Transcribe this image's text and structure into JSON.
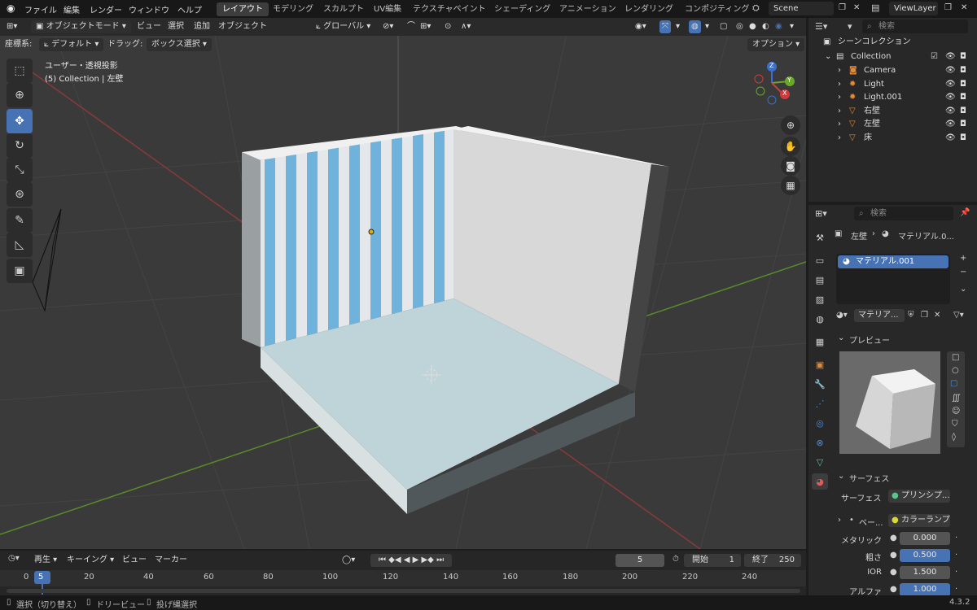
{
  "top_menu": {
    "items": [
      "ファイル",
      "編集",
      "レンダー",
      "ウィンドウ",
      "ヘルプ"
    ]
  },
  "workspace_tabs": [
    "レイアウト",
    "モデリング",
    "スカルプト",
    "UV編集",
    "テクスチャペイント",
    "シェーディング",
    "アニメーション",
    "レンダリング",
    "コンポジティング"
  ],
  "scene": {
    "name": "Scene",
    "view_layer": "ViewLayer"
  },
  "viewport": {
    "mode": "オブジェクトモード",
    "menus": [
      "ビュー",
      "選択",
      "追加",
      "オブジェクト"
    ],
    "transform_orientation": "グローバル",
    "coord_label": "座標系:",
    "coord_value": "デフォルト",
    "drag_label": "ドラッグ:",
    "drag_value": "ボックス選択",
    "options": "オプション",
    "overlay_title": "ユーザー・透視投影",
    "overlay_sub": "(5) Collection | 左壁"
  },
  "gizmo": {
    "z": "Z",
    "y": "Y",
    "x": "X"
  },
  "outliner": {
    "search_placeholder": "検索",
    "scene_collection": "シーンコレクション",
    "collection": "Collection",
    "items": [
      {
        "name": "Camera",
        "icon": "camera-icon",
        "color": "#e08a3a"
      },
      {
        "name": "Light",
        "icon": "light-icon",
        "color": "#e08a3a"
      },
      {
        "name": "Light.001",
        "icon": "light-icon",
        "color": "#e08a3a"
      },
      {
        "name": "右壁",
        "icon": "mesh-icon",
        "color": "#e08a3a"
      },
      {
        "name": "左壁",
        "icon": "mesh-icon",
        "color": "#e08a3a"
      },
      {
        "name": "床",
        "icon": "mesh-icon",
        "color": "#e08a3a"
      }
    ]
  },
  "properties": {
    "search_placeholder": "検索",
    "breadcrumb_object": "左壁",
    "breadcrumb_material": "マテリアル.0...",
    "slot": "マテリアル.001",
    "material_field": "マテリア...",
    "preview_label": "プレビュー",
    "surface_section": "サーフェス",
    "surface_label": "サーフェス",
    "surface_value": "プリンシプ...",
    "base_label": "ベー...",
    "base_value": "カラーランプ",
    "rows": [
      {
        "label": "メタリック",
        "value": "0.000",
        "highlight": false
      },
      {
        "label": "粗さ",
        "value": "0.500",
        "highlight": true
      },
      {
        "label": "IOR",
        "value": "1.500",
        "highlight": false
      },
      {
        "label": "アルファ",
        "value": "1.000",
        "highlight": true
      }
    ]
  },
  "timeline": {
    "play": "再生",
    "keying": "キーイング",
    "view": "ビュー",
    "marker": "マーカー",
    "current_frame": "5",
    "start_label": "開始",
    "start": "1",
    "end_label": "終了",
    "end": "250",
    "ticks": [
      "0",
      "5",
      "20",
      "40",
      "60",
      "80",
      "100",
      "120",
      "140",
      "160",
      "180",
      "200",
      "220",
      "240"
    ]
  },
  "status": {
    "select": "選択（切り替え）",
    "dolly": "ドリービュー",
    "lasso": "投げ縄選択",
    "version": "4.3.2"
  },
  "colors": {
    "accent": "#4772b3",
    "stripe": "#6fb3dc",
    "floor": "#bfd4d8"
  }
}
